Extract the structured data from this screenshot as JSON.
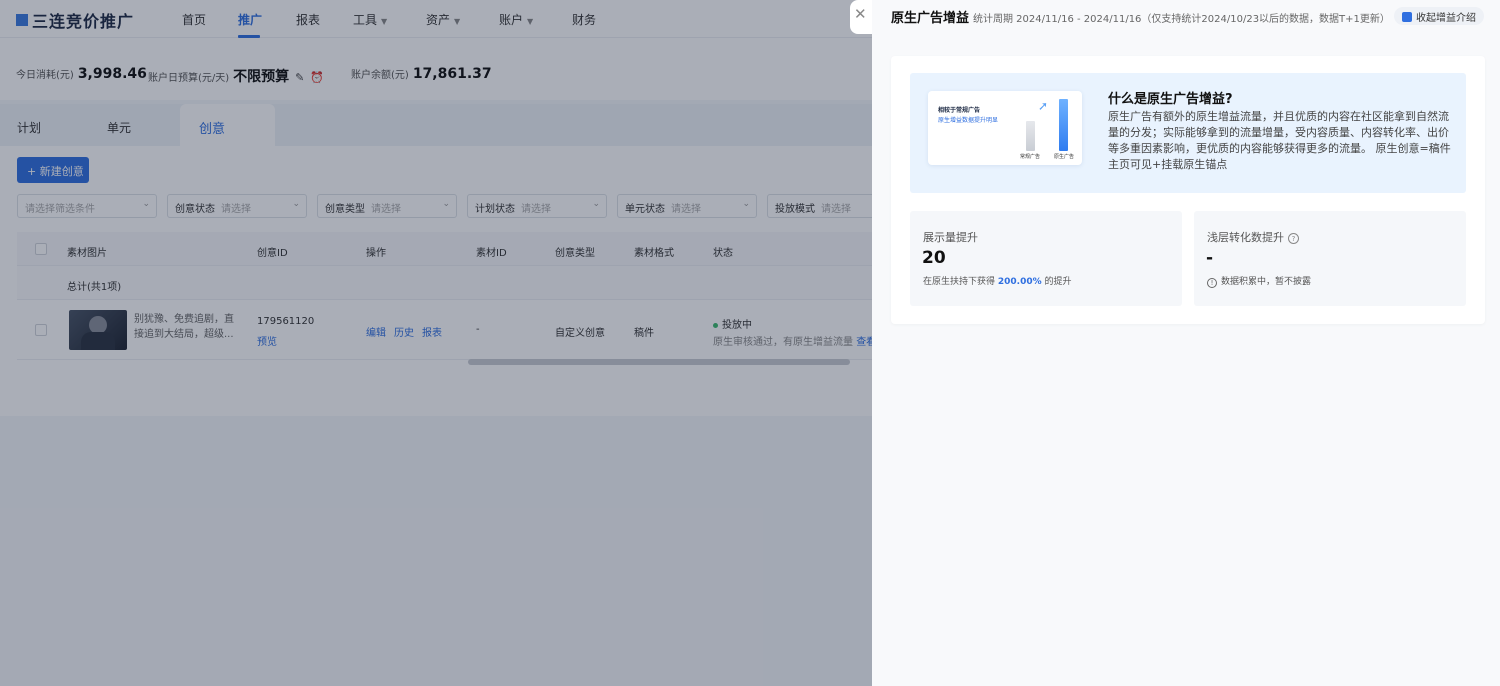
{
  "app": {
    "logo": "三连竞价推广",
    "nav": [
      {
        "label": "首页"
      },
      {
        "label": "推广"
      },
      {
        "label": "报表"
      },
      {
        "label": "工具"
      },
      {
        "label": "资产"
      },
      {
        "label": "账户"
      },
      {
        "label": "财务"
      }
    ],
    "stats": {
      "today_spend_label": "今日消耗(元)",
      "today_spend_value": "3,998.46",
      "daily_budget_label": "账户日预算(元/天)",
      "daily_budget_value": "不限预算",
      "balance_label": "账户余额(元)",
      "balance_value": "17,861.37"
    },
    "tabs": [
      "计划",
      "单元",
      "创意"
    ],
    "new_button": "+ 新建创意",
    "filters": [
      {
        "label": "",
        "placeholder": "请选择筛选条件"
      },
      {
        "label": "创意状态",
        "placeholder": "请选择"
      },
      {
        "label": "创意类型",
        "placeholder": "请选择"
      },
      {
        "label": "计划状态",
        "placeholder": "请选择"
      },
      {
        "label": "单元状态",
        "placeholder": "请选择"
      },
      {
        "label": "投放模式",
        "placeholder": "请选择"
      }
    ],
    "table": {
      "headers": [
        "素材图片",
        "创意ID",
        "操作",
        "素材ID",
        "创意类型",
        "素材格式",
        "状态"
      ],
      "total_label": "总计(共1项)",
      "row": {
        "desc": "别犹豫、免费追剧，直接追到大结局，超级...",
        "creative_id": "179561120",
        "preview": "预览",
        "ops": [
          "编辑",
          "历史",
          "报表"
        ],
        "material_id": "-",
        "creative_type": "自定义创意",
        "material_format": "稿件",
        "status": "投放中",
        "status_note": "原生审核通过，有原生增益流量",
        "view": "查看"
      }
    }
  },
  "drawer": {
    "title": "原生广告增益",
    "subtitle": "统计周期 2024/11/16 - 2024/11/16（仅支持统计2024/10/23以后的数据，数据T+1更新）",
    "collapse_label": "收起增益介绍",
    "intro": {
      "illus_title": "相较于常规广告",
      "illus_subtitle": "原生增益数据提升明显",
      "bar1_label": "常规广告",
      "bar2_label": "原生广告",
      "title": "什么是原生广告增益?",
      "text": "原生广告有额外的原生增益流量，并且优质的内容在社区能拿到自然流量的分发；实际能够拿到的流量增量，受内容质量、内容转化率、出价等多重因素影响，更优质的内容能够获得更多的流量。 原生创意=稿件主页可见+挂载原生锚点"
    },
    "metrics": [
      {
        "label": "展示量提升",
        "value": "20",
        "note_prefix": "在原生扶持下获得",
        "note_highlight": "200.00%",
        "note_suffix": "的提升"
      },
      {
        "label": "浅层转化数提升",
        "value": "-",
        "note": "数据积累中，暂不披露"
      }
    ]
  }
}
